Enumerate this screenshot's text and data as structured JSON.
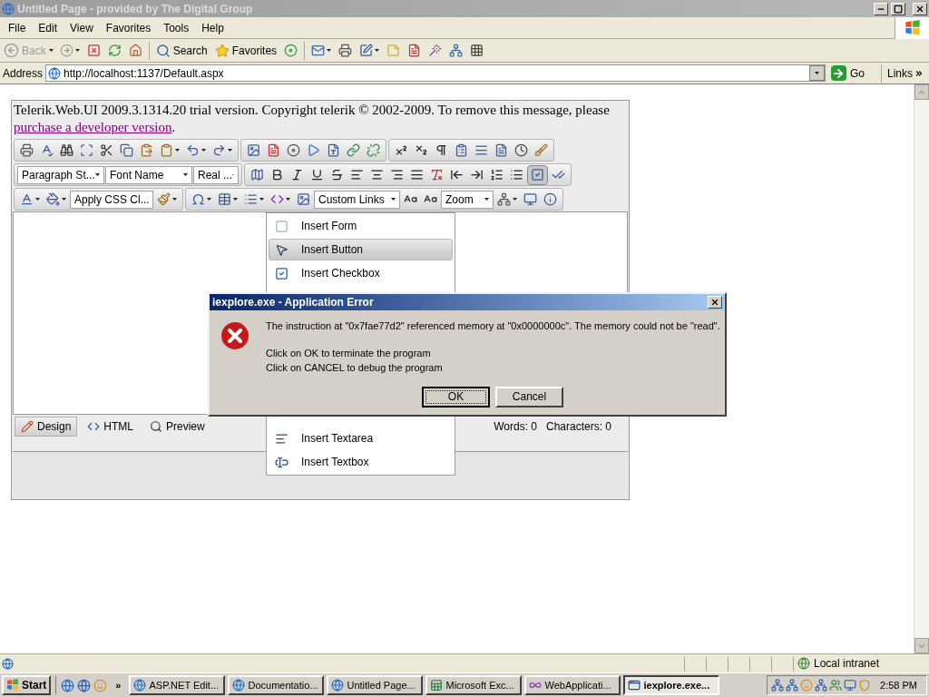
{
  "window": {
    "title": "Untitled Page - provided by The Digital Group",
    "active": false
  },
  "menu": [
    "File",
    "Edit",
    "View",
    "Favorites",
    "Tools",
    "Help"
  ],
  "toolbar": {
    "back": "Back",
    "back_disabled": true,
    "search": "Search",
    "favorites": "Favorites"
  },
  "address": {
    "label": "Address",
    "url": "http://localhost:1137/Default.aspx",
    "go": "Go",
    "links": "Links"
  },
  "page": {
    "notice": "Telerik.Web.UI 2009.3.1314.20 trial version. Copyright telerik © 2002-2009. To remove this message, please",
    "link": "purchase a developer version",
    "after": "."
  },
  "editor": {
    "dropdowns_row2": [
      "Paragraph St...",
      "Font Name",
      "Real ..."
    ],
    "css_dropdown": "Apply CSS Cl...",
    "links_dropdown": "Custom Links",
    "zoom_dropdown": "Zoom",
    "modes": [
      {
        "label": "Design",
        "kind": "design",
        "selected": true
      },
      {
        "label": "HTML",
        "kind": "html",
        "selected": false
      },
      {
        "label": "Preview",
        "kind": "preview",
        "selected": false
      }
    ],
    "words": "Words: 0",
    "characters": "Characters: 0"
  },
  "insert_menu": {
    "items": [
      {
        "label": "Insert Form",
        "kind": "form",
        "selected": false,
        "gap_before": false
      },
      {
        "label": "Insert Button",
        "kind": "button",
        "selected": true,
        "gap_before": false
      },
      {
        "label": "Insert Checkbox",
        "kind": "checkbox",
        "selected": false,
        "gap_before": false
      },
      {
        "label": "Insert Textarea",
        "kind": "textarea",
        "selected": false,
        "gap_before": true
      },
      {
        "label": "Insert Textbox",
        "kind": "textbox",
        "selected": false,
        "gap_before": false
      }
    ]
  },
  "dialog": {
    "title": "iexplore.exe - Application Error",
    "message": "The instruction at \"0x7fae77d2\" referenced memory at \"0x0000000c\". The memory could not be \"read\".",
    "lines": [
      "Click on OK to terminate the program",
      "Click on CANCEL to debug the program"
    ],
    "buttons": [
      {
        "label": "OK",
        "default": true
      },
      {
        "label": "Cancel",
        "default": false
      }
    ]
  },
  "status_bar": {
    "zone": "Local intranet"
  },
  "taskbar": {
    "start": "Start",
    "more": "»",
    "clock": "2:58 PM",
    "tasks": [
      {
        "label": "ASP.NET Edit...",
        "kind": "ie",
        "selected": false
      },
      {
        "label": "Documentatio...",
        "kind": "ie",
        "selected": false
      },
      {
        "label": "Untitled Page...",
        "kind": "ie",
        "selected": false
      },
      {
        "label": "Microsoft Exc...",
        "kind": "excel",
        "selected": false
      },
      {
        "label": "WebApplicati...",
        "kind": "vs",
        "selected": false
      },
      {
        "label": "iexplore.exe...",
        "kind": "window",
        "selected": true
      }
    ]
  }
}
